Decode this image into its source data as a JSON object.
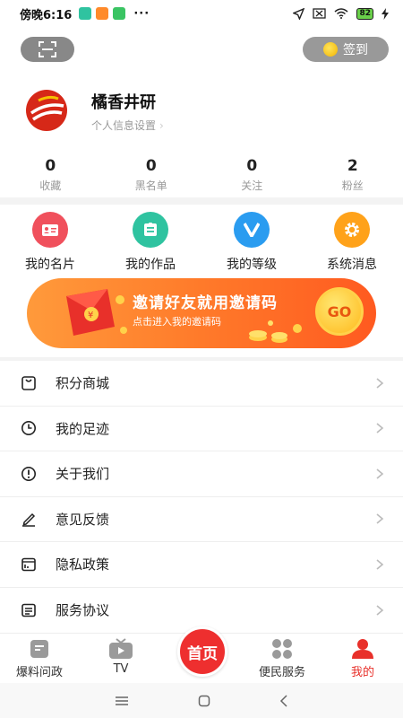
{
  "status_bar": {
    "time": "傍晚6:16",
    "dots": "···",
    "battery": "82"
  },
  "header": {
    "checkin_label": "签到"
  },
  "profile": {
    "username": "橘香井研",
    "settings_link": "个人信息设置",
    "settings_chevron": "›"
  },
  "stats": [
    {
      "value": "0",
      "label": "收藏"
    },
    {
      "value": "0",
      "label": "黑名单"
    },
    {
      "value": "0",
      "label": "关注"
    },
    {
      "value": "2",
      "label": "粉丝"
    }
  ],
  "quick_actions": [
    {
      "label": "我的名片",
      "icon": "card-icon",
      "color": "#f0505c"
    },
    {
      "label": "我的作品",
      "icon": "document-icon",
      "color": "#2fc3a0"
    },
    {
      "label": "我的等级",
      "icon": "level-v-icon",
      "color": "#2a9cf0"
    },
    {
      "label": "系统消息",
      "icon": "gear-icon",
      "color": "#ffa21a"
    }
  ],
  "banner": {
    "title": "邀请好友就用邀请码",
    "subtitle": "点击进入我的邀请码",
    "button": "GO"
  },
  "menu": [
    {
      "label": "积分商城",
      "icon": "mall-bag-icon"
    },
    {
      "label": "我的足迹",
      "icon": "clock-icon"
    },
    {
      "label": "关于我们",
      "icon": "info-exclamation-icon"
    },
    {
      "label": "意见反馈",
      "icon": "pen-icon"
    },
    {
      "label": "隐私政策",
      "icon": "privacy-icon"
    },
    {
      "label": "服务协议",
      "icon": "agreement-icon"
    }
  ],
  "tabbar": {
    "tabs": [
      {
        "label": "爆料问政",
        "icon": "report-icon"
      },
      {
        "label": "TV",
        "icon": "tv-icon"
      },
      {
        "label": "首页",
        "icon": "home-icon"
      },
      {
        "label": "便民服务",
        "icon": "grid-icon"
      },
      {
        "label": "我的",
        "icon": "user-icon"
      }
    ],
    "active": "我的"
  },
  "colors": {
    "accent": "#e8302a",
    "banner": "#ff7a2a"
  }
}
